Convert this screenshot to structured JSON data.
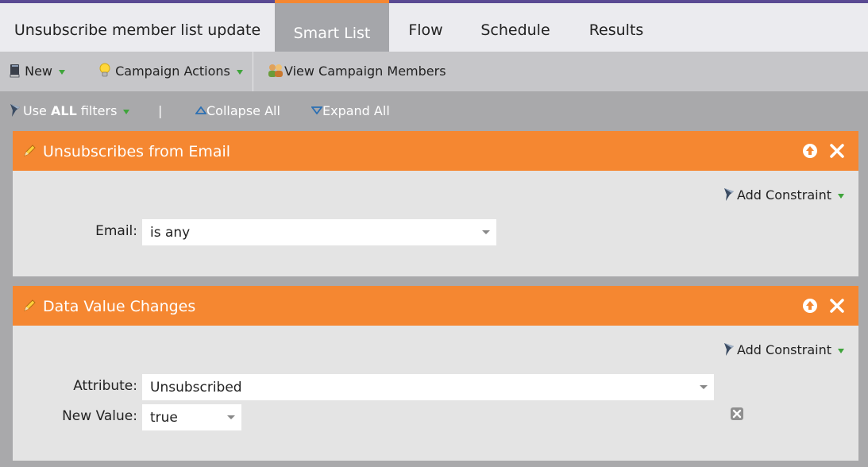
{
  "tabs": {
    "title": "Unsubscribe member list update",
    "items": [
      {
        "label": "Smart List",
        "active": true
      },
      {
        "label": "Flow",
        "active": false
      },
      {
        "label": "Schedule",
        "active": false
      },
      {
        "label": "Results",
        "active": false
      }
    ]
  },
  "toolbar": {
    "new_label": "New",
    "campaign_actions_label": "Campaign Actions",
    "view_members_label": "View Campaign Members"
  },
  "filterbar": {
    "use_prefix": "Use ",
    "use_bold": "ALL",
    "use_suffix": " filters",
    "separator": "|",
    "collapse_label": "Collapse All",
    "expand_label": "Expand All"
  },
  "filters": [
    {
      "title": "Unsubscribes from Email",
      "add_constraint": "Add Constraint",
      "fields": [
        {
          "label": "Email:",
          "value": "is any"
        }
      ]
    },
    {
      "title": "Data Value Changes",
      "add_constraint": "Add Constraint",
      "fields": [
        {
          "label": "Attribute:",
          "value": "Unsubscribed"
        },
        {
          "label": "New Value:",
          "value": "true"
        }
      ]
    }
  ],
  "colors": {
    "accent_orange": "#f58731",
    "top_bar_purple": "#5a4a93",
    "dropdown_green": "#3fa43b"
  },
  "icons": [
    "book-icon",
    "lightbulb-icon",
    "people-icon",
    "funnel-icon",
    "collapse-triangle-icon",
    "expand-triangle-icon",
    "pencil-icon",
    "move-up-icon",
    "close-icon",
    "remove-constraint-icon"
  ]
}
